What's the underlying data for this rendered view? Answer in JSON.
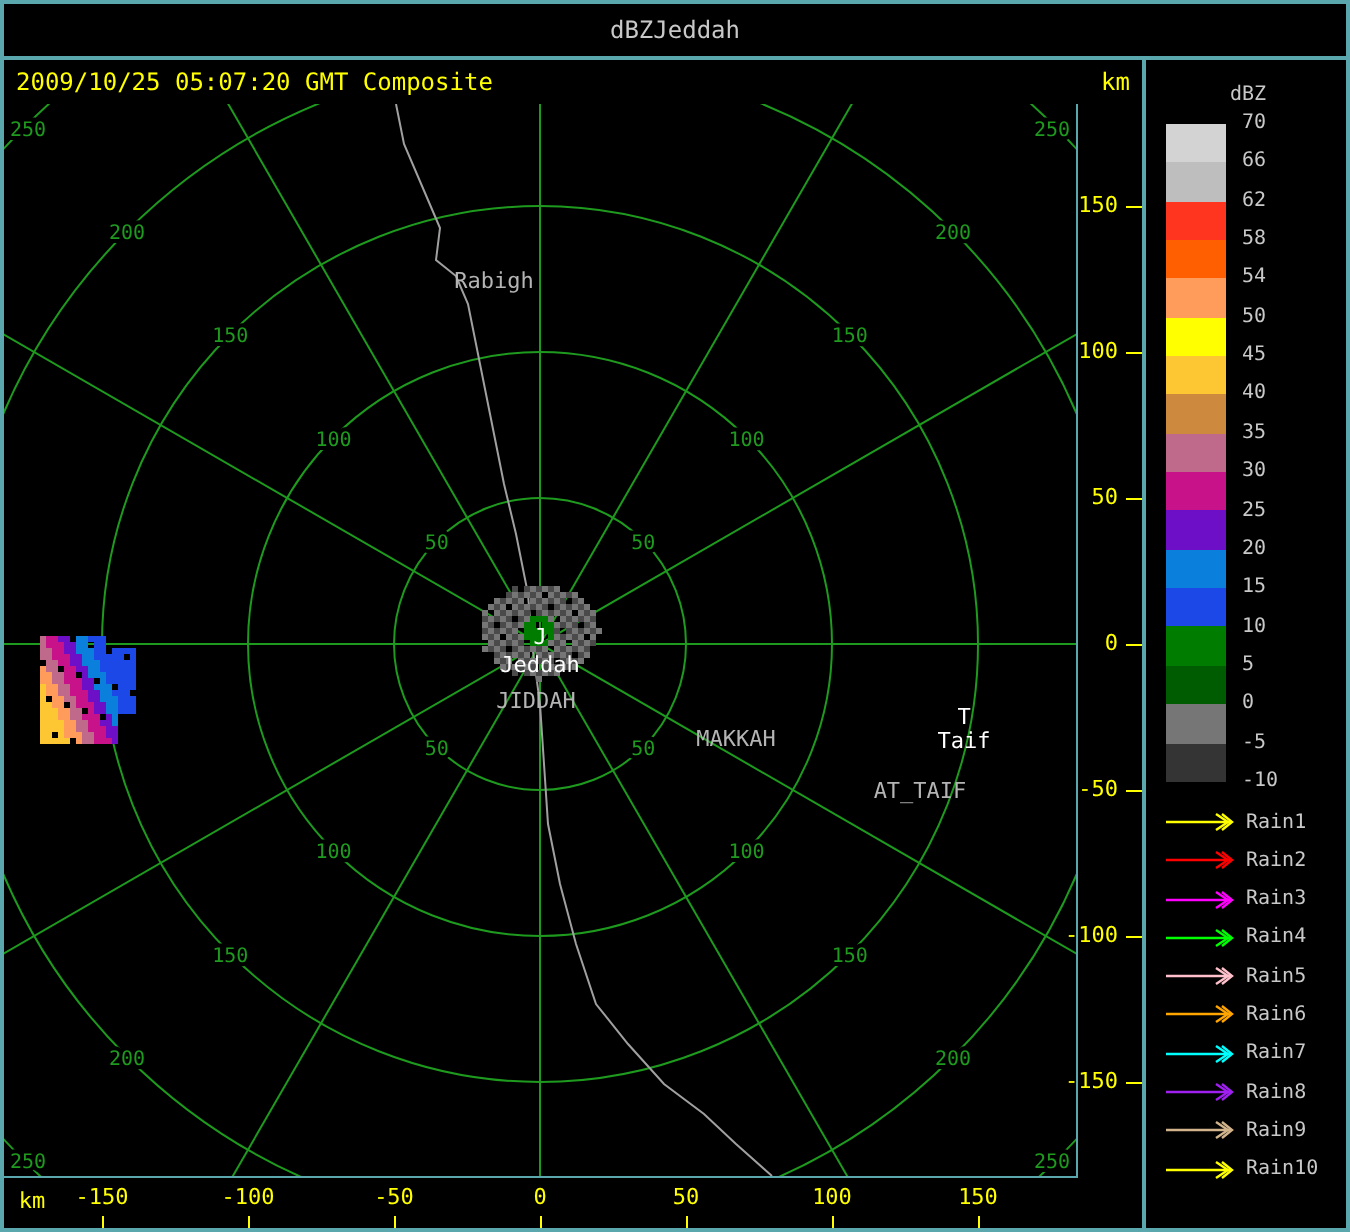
{
  "window": {
    "title": "dBZJeddah"
  },
  "header": {
    "timestamp": "2009/10/25 05:07:20 GMT Composite",
    "unit": "km"
  },
  "rings": [
    {
      "labels": [
        "50",
        "50",
        "50",
        "50"
      ]
    },
    {
      "labels": [
        "100",
        "100",
        "100",
        "100"
      ]
    },
    {
      "labels": [
        "150",
        "150",
        "150",
        "150"
      ]
    },
    {
      "labels": [
        "200",
        "200",
        "200",
        "200"
      ]
    },
    {
      "labels": [
        "250",
        "250",
        "250",
        "250"
      ]
    }
  ],
  "map_labels": [
    {
      "text": "Rabigh",
      "kind": "place"
    },
    {
      "text": "J",
      "kind": "site"
    },
    {
      "text": "Jeddah",
      "kind": "site"
    },
    {
      "text": "JIDDAH",
      "kind": "place"
    },
    {
      "text": "MAKKAH",
      "kind": "place"
    },
    {
      "text": "T",
      "kind": "site"
    },
    {
      "text": "Taif",
      "kind": "site"
    },
    {
      "text": "AT_TAIF",
      "kind": "place"
    }
  ],
  "y_axis": {
    "ticks": [
      "150",
      "100",
      "50",
      "0",
      "-50",
      "-100",
      "-150"
    ]
  },
  "x_axis": {
    "unit": "km",
    "ticks": [
      "-150",
      "-100",
      "-50",
      "0",
      "50",
      "100",
      "150"
    ]
  },
  "legend": {
    "title": "dBZ",
    "bins": [
      {
        "color": "#d3d3d3"
      },
      {
        "color": "#bebebe"
      },
      {
        "color": "#ff3520"
      },
      {
        "color": "#ff5f00"
      },
      {
        "color": "#ff9c5c"
      },
      {
        "color": "#ffff00"
      },
      {
        "color": "#fdc633"
      },
      {
        "color": "#cd8a3e"
      },
      {
        "color": "#bf6a8a"
      },
      {
        "color": "#c8128a"
      },
      {
        "color": "#6e0fc8"
      },
      {
        "color": "#0a80dc"
      },
      {
        "color": "#1c48e8"
      },
      {
        "color": "#007d00"
      },
      {
        "color": "#005c00"
      },
      {
        "color": "#767676"
      },
      {
        "color": "#343434"
      }
    ],
    "scale_labels": [
      "70",
      "66",
      "62",
      "58",
      "54",
      "50",
      "45",
      "40",
      "35",
      "30",
      "25",
      "20",
      "15",
      "10",
      "5",
      "0",
      "-5",
      "-10"
    ],
    "tracks": [
      {
        "label": "Rain1",
        "color": "#ffff00"
      },
      {
        "label": "Rain2",
        "color": "#ff0000"
      },
      {
        "label": "Rain3",
        "color": "#ff00ff"
      },
      {
        "label": "Rain4",
        "color": "#00ff00"
      },
      {
        "label": "Rain5",
        "color": "#ffc0cb"
      },
      {
        "label": "Rain6",
        "color": "#ffa500"
      },
      {
        "label": "Rain7",
        "color": "#00ffff"
      },
      {
        "label": "Rain8",
        "color": "#a020f0"
      },
      {
        "label": "Rain9",
        "color": "#d2b48c"
      },
      {
        "label": "Rain10",
        "color": "#ffff00"
      }
    ]
  }
}
